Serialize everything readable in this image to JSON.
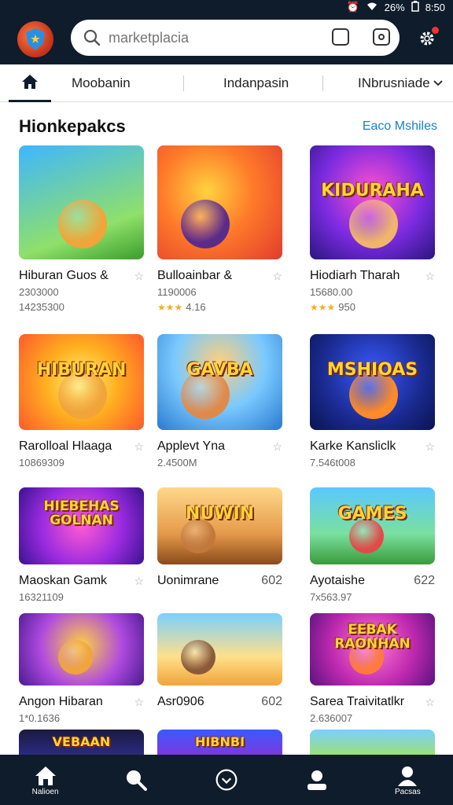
{
  "status": {
    "alarm": "⏰",
    "wifi": "WiFi",
    "battery": "26%",
    "time": "8:50"
  },
  "search": {
    "placeholder": "marketplacia"
  },
  "tabs": [
    {
      "label": "Moobanin"
    },
    {
      "label": "Indanpasin"
    },
    {
      "label": "INbrusniade"
    }
  ],
  "section": {
    "title": "Hionkepakcs",
    "see_more": "Eaco Mshiles"
  },
  "games": [
    {
      "title": "Hiburan Guos &",
      "meta1": "2303000",
      "meta2": "14235300",
      "thumb_text": "",
      "bg": "linear-gradient(160deg,#3fb6ff 0%,#8fe06a 70%,#3a9e2c 100%)",
      "mascot": "#f0a43a"
    },
    {
      "title": "Bulloainbar &",
      "meta1": "1190006",
      "rating": "★★★",
      "rating_text": "4.16",
      "thumb_text": "",
      "bg": "radial-gradient(circle at 40% 40%,#ffd23f 0%,#ff7b2a 45%,#e23c2d 100%)",
      "mascot": "#5b2b8a"
    },
    {
      "title": "Hiodiarh Tharah",
      "meta1": "15680.00",
      "rating": "★★★",
      "rating_text": "950",
      "thumb_text": "KIDURAHA",
      "bg": "radial-gradient(circle at 50% 40%,#ff4fd1 0%,#7b2be0 55%,#2a1580 100%)",
      "mascot": "#f2b46b"
    },
    {
      "title": "Rarolloal Hlaaga",
      "meta1": "10869309",
      "thumb_text": "HIBURAN",
      "bg": "radial-gradient(circle at 50% 50%,#fff27a 0%,#ffb020 45%,#ff5a2a 100%)",
      "mascot": "#f0a43a"
    },
    {
      "title": "Applevt Yna",
      "meta1": "2.4500M",
      "thumb_text": "GAVBA",
      "bg": "radial-gradient(circle at 50% 30%,#ffd07a 0%,#7ac9ff 50%,#2a7ad0 100%)",
      "mascot": "#e08a4a"
    },
    {
      "title": "Karke Kansliclk",
      "meta1": "7.546t008",
      "thumb_text": "MSHIOAS",
      "bg": "radial-gradient(circle at 50% 40%,#3a5bff 0%,#1a2a90 60%,#0a1450 100%)",
      "mascot": "#ff8a2a"
    },
    {
      "title": "Maoskan Gamk",
      "meta1": "16321109",
      "thumb_text": "HIEBEHAS GOLNAN",
      "bg": "radial-gradient(circle at 50% 50%,#ff5ad0 0%,#9a2be0 55%,#3a1290 100%)",
      "mascot": ""
    },
    {
      "title": "Uonimrane",
      "side_value": "602",
      "thumb_text": "NUWIN",
      "bg": "linear-gradient(180deg,#ffd88a 0%,#e59a4a 60%,#8a4a1a 100%)",
      "mascot": "#c2783a"
    },
    {
      "title": "Ayotaishe",
      "side_value": "622",
      "meta1": "7x563.97",
      "thumb_text": "GAMES",
      "bg": "linear-gradient(180deg,#5ac8ff 0%,#7ae0a0 60%,#3a9a3a 100%)",
      "mascot": "#e24a4a"
    },
    {
      "title": "Angon Hibaran",
      "meta1": "1*0.1636",
      "thumb_text": "",
      "bg": "radial-gradient(circle at 50% 45%,#ffd23f 0%,#b04ae0 55%,#4a1a90 100%)",
      "mascot": "#f0a43a"
    },
    {
      "title": "Asr0906",
      "side_value": "602",
      "thumb_text": "",
      "bg": "linear-gradient(180deg,#7ad0ff 0%,#ffe08a 60%,#f0a43a 100%)",
      "mascot": "#8a5a3a"
    },
    {
      "title": "Sarea Traivitatlkr",
      "meta1": "2.636007",
      "thumb_text": "EEBAK RAONHAN",
      "bg": "radial-gradient(circle at 50% 45%,#ff7ad0 0%,#c02ab0 55%,#5a1280 100%)",
      "mascot": "#ff7a3a"
    }
  ],
  "peek": [
    {
      "thumb_text": "VEBAAN",
      "bg": "linear-gradient(180deg,#1a1a40 0%,#2a2a80 100%)"
    },
    {
      "thumb_text": "HIBNBI",
      "bg": "linear-gradient(180deg,#3a5aff 0%,#7a3ae0 100%)"
    },
    {
      "thumb_text": "",
      "bg": "linear-gradient(180deg,#7ad0ff 0%,#9ae07a 100%)"
    }
  ],
  "bottom_nav": [
    {
      "icon": "home-icon",
      "label": "Nalioen"
    },
    {
      "icon": "search-icon",
      "label": ""
    },
    {
      "icon": "download-icon",
      "label": ""
    },
    {
      "icon": "profile-icon",
      "label": ""
    },
    {
      "icon": "account-icon",
      "label": "Pacsas"
    }
  ],
  "colors": {
    "appbar": "#0f1c2b",
    "link": "#1a7fc9",
    "star": "#f2b01e"
  }
}
